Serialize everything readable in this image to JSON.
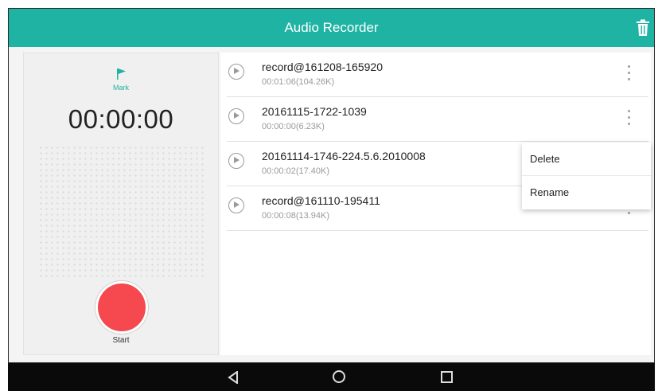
{
  "app": {
    "title": "Audio Recorder"
  },
  "recorder": {
    "mark_label": "Mark",
    "timer": "00:00:00",
    "start_label": "Start"
  },
  "recordings": [
    {
      "name": "record@161208-165920",
      "meta": "00:01:06(104.26K)"
    },
    {
      "name": "20161115-1722-1039",
      "meta": "00:00:00(6.23K)"
    },
    {
      "name": "20161114-1746-224.5.6.2010008",
      "meta": "00:00:02(17.40K)"
    },
    {
      "name": "record@161110-195411",
      "meta": "00:00:08(13.94K)"
    }
  ],
  "context_menu": {
    "items": [
      "Delete",
      "Rename"
    ]
  },
  "colors": {
    "accent": "#1fb3a3",
    "record": "#f5484f"
  }
}
